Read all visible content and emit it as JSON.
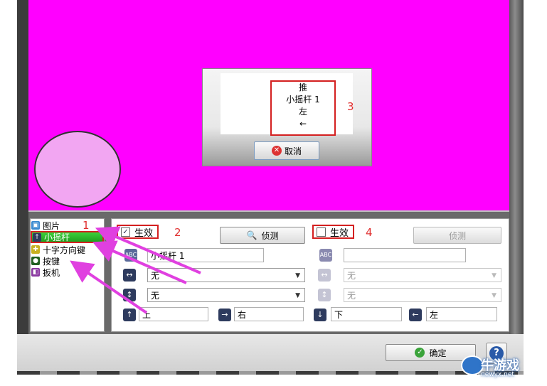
{
  "popup": {
    "line1": "推",
    "line2": "小摇杆 1",
    "line3": "左",
    "arrow_glyph": "←",
    "annotation": "3",
    "cancel_label": "取消"
  },
  "list": {
    "items": [
      {
        "label": "图片",
        "icon": "picture-icon"
      },
      {
        "label": "小摇杆",
        "icon": "joystick-icon"
      },
      {
        "label": "十字方向键",
        "icon": "dpad-icon"
      },
      {
        "label": "按键",
        "icon": "button-icon"
      },
      {
        "label": "扳机",
        "icon": "trigger-icon"
      }
    ],
    "annotation": "1"
  },
  "left": {
    "enabled_label": "生效",
    "enabled_checked": true,
    "annotation": "2",
    "detect_label": "侦测",
    "name_value": "小摇杆 1",
    "horizontal_value": "无",
    "vertical_value": "无"
  },
  "right": {
    "enabled_label": "生效",
    "enabled_checked": false,
    "annotation": "4",
    "detect_label": "侦测",
    "name_value": "",
    "horizontal_value": "无",
    "vertical_value": "无"
  },
  "directions": {
    "up": "上",
    "right": "右",
    "down": "下",
    "left": "左"
  },
  "footer": {
    "ok_label": "确定",
    "help_glyph": "?"
  },
  "watermark": {
    "text": "牛游戏",
    "sub": "newyx.net"
  },
  "colors": {
    "canvas": "#ff00ff",
    "annotation_red": "#e03030",
    "arrow_magenta": "#e040e0"
  }
}
